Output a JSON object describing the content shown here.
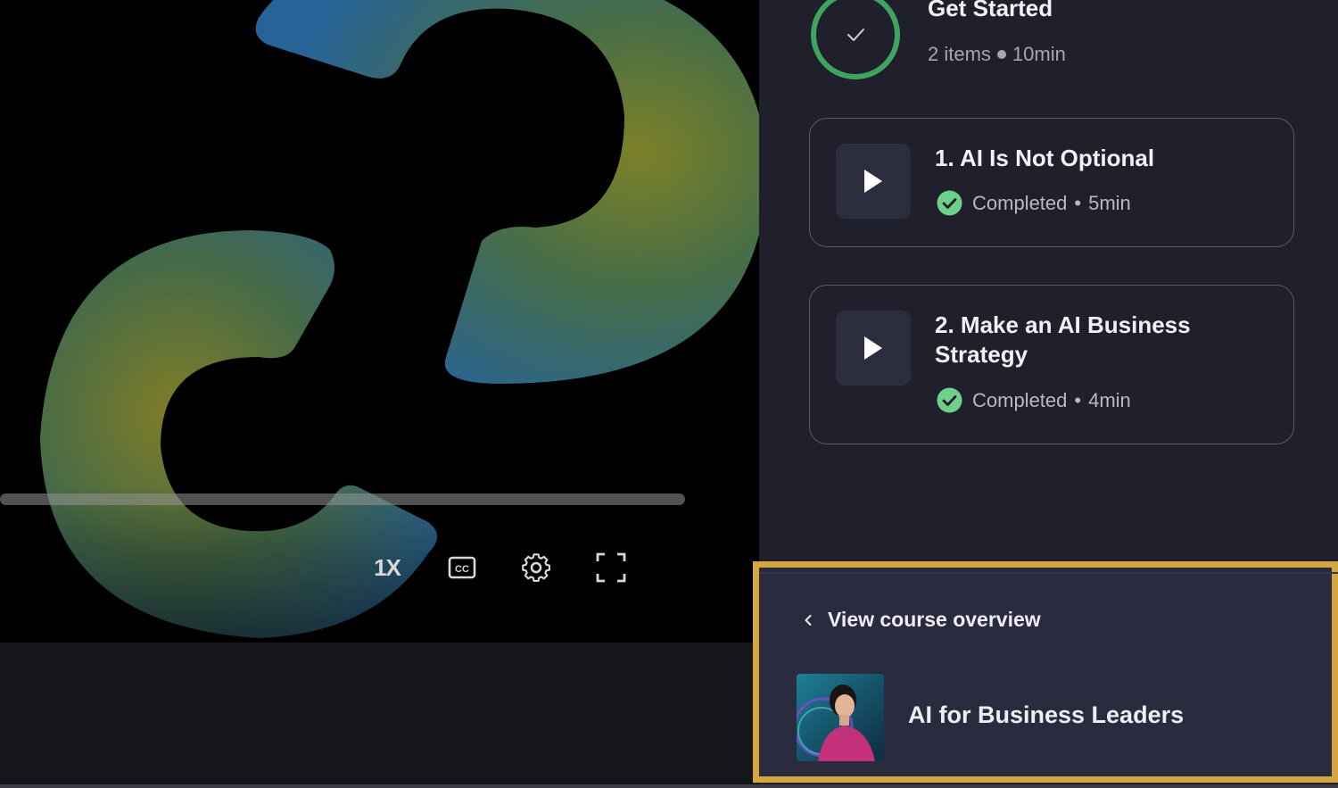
{
  "player": {
    "speed_label": "1X",
    "cc_label": "CC",
    "progress": 0.0
  },
  "section": {
    "title": "Get Started",
    "item_count": "2 items",
    "duration": "10min"
  },
  "lessons": [
    {
      "title": "1. AI Is Not Optional",
      "status": "Completed",
      "duration": "5min"
    },
    {
      "title": "2. Make an AI Business Strategy",
      "status": "Completed",
      "duration": "4min"
    }
  ],
  "footer": {
    "overview_link": "View course overview",
    "course_title": "AI for Business Leaders"
  },
  "colors": {
    "accent_highlight": "#d4a640",
    "complete_green": "#3fa45f",
    "check_badge": "#6fd08c"
  }
}
